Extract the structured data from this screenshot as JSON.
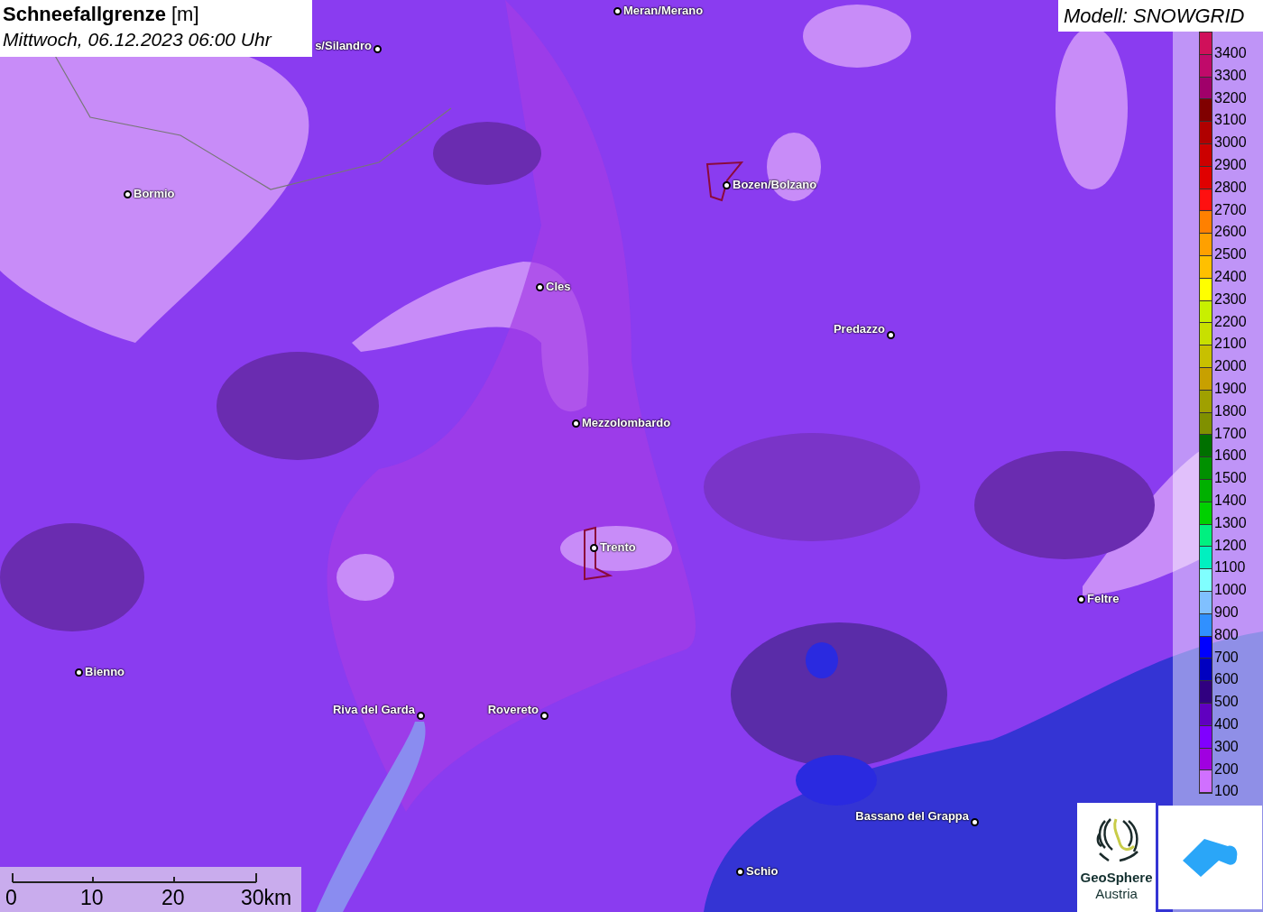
{
  "title": {
    "text": "Schneefallgrenze",
    "unit": "[m]",
    "date": "Mittwoch, 06.12.2023 06:00 Uhr"
  },
  "model_label": "Modell: SNOWGRID",
  "cities": [
    {
      "name": "Meran/Merano"
    },
    {
      "name": "s/Silandro"
    },
    {
      "name": "Bormio"
    },
    {
      "name": "Bozen/Bolzano"
    },
    {
      "name": "Cles"
    },
    {
      "name": "Predazzo"
    },
    {
      "name": "Mezzolombardo"
    },
    {
      "name": "Trento"
    },
    {
      "name": "Feltre"
    },
    {
      "name": "Bienno"
    },
    {
      "name": "Riva del Garda"
    },
    {
      "name": "Rovereto"
    },
    {
      "name": "Bassano del Grappa"
    },
    {
      "name": "Schio"
    }
  ],
  "legend": [
    {
      "label": "3400",
      "color": "#d0105a"
    },
    {
      "label": "3300",
      "color": "#c00a6a"
    },
    {
      "label": "3200",
      "color": "#a0006a"
    },
    {
      "label": "3100",
      "color": "#800000"
    },
    {
      "label": "3000",
      "color": "#b00000"
    },
    {
      "label": "2900",
      "color": "#cc0000"
    },
    {
      "label": "2800",
      "color": "#e00000"
    },
    {
      "label": "2700",
      "color": "#ff1010"
    },
    {
      "label": "2600",
      "color": "#ff8000"
    },
    {
      "label": "2500",
      "color": "#ffa000"
    },
    {
      "label": "2400",
      "color": "#ffc000"
    },
    {
      "label": "2300",
      "color": "#ffff00"
    },
    {
      "label": "2200",
      "color": "#c8f000"
    },
    {
      "label": "2100",
      "color": "#c8e000"
    },
    {
      "label": "2000",
      "color": "#c8c000"
    },
    {
      "label": "1900",
      "color": "#c8a000"
    },
    {
      "label": "1800",
      "color": "#a0a000"
    },
    {
      "label": "1700",
      "color": "#809000"
    },
    {
      "label": "1600",
      "color": "#007000"
    },
    {
      "label": "1500",
      "color": "#009000"
    },
    {
      "label": "1400",
      "color": "#00b000"
    },
    {
      "label": "1300",
      "color": "#00d000"
    },
    {
      "label": "1200",
      "color": "#00f080"
    },
    {
      "label": "1100",
      "color": "#00f0c0"
    },
    {
      "label": "1000",
      "color": "#80ffff"
    },
    {
      "label": "900",
      "color": "#80c0ff"
    },
    {
      "label": "800",
      "color": "#3090ff"
    },
    {
      "label": "700",
      "color": "#0000ff"
    },
    {
      "label": "600",
      "color": "#0000c0"
    },
    {
      "label": "500",
      "color": "#300080"
    },
    {
      "label": "400",
      "color": "#6000c0"
    },
    {
      "label": "300",
      "color": "#8000ff"
    },
    {
      "label": "200",
      "color": "#a000e0"
    },
    {
      "label": "100",
      "color": "#d070ff"
    }
  ],
  "scale_bar": {
    "ticks": [
      "0",
      "10",
      "20",
      "30km"
    ]
  },
  "logo": {
    "name": "GeoSphere",
    "subtitle": "Austria"
  }
}
